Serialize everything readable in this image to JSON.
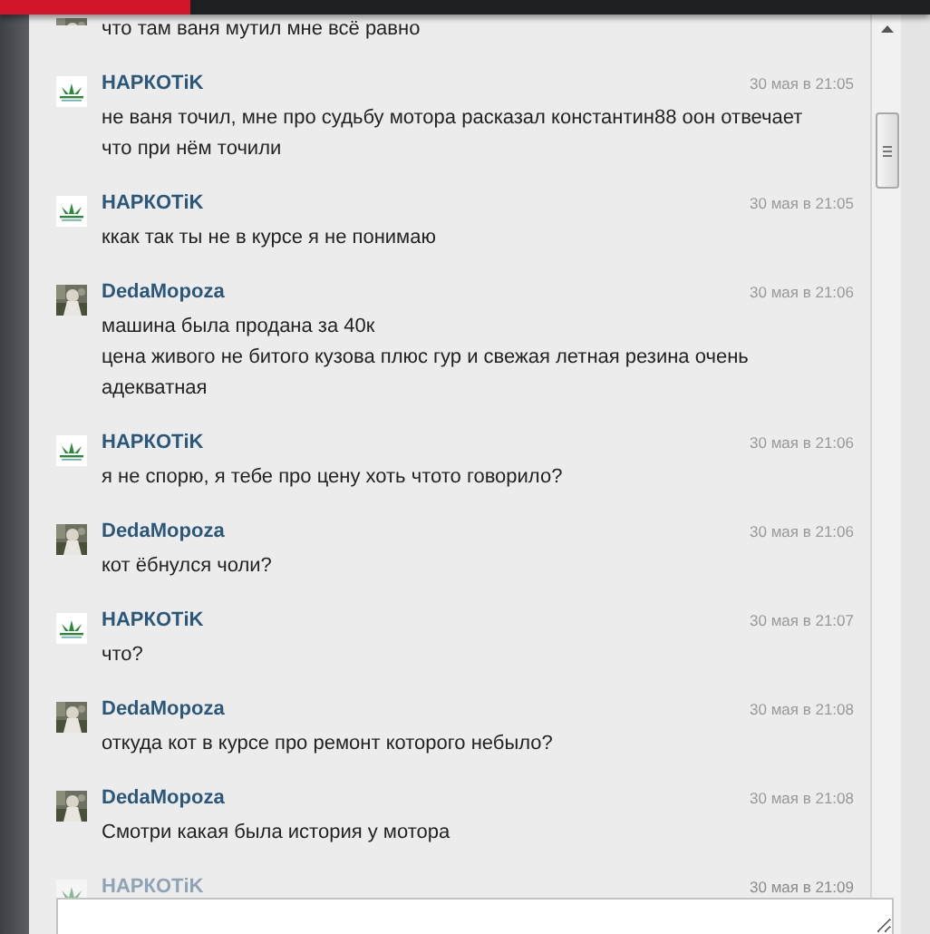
{
  "messages": [
    {
      "continued": true,
      "lines": [
        "что там ваня мутил мне всё равно"
      ]
    },
    {
      "kind": "logo",
      "author": "НАРКОТiK",
      "time": "30 мая в 21:05",
      "faded": false,
      "lines": [
        "не ваня точил, мне про судьбу мотора расказал константин88 оон отвечает что при нём точили"
      ]
    },
    {
      "kind": "logo",
      "author": "НАРКОТiK",
      "time": "30 мая в 21:05",
      "faded": false,
      "lines": [
        "ккак так ты не в курсе я не понимаю"
      ]
    },
    {
      "author": "DedaMopoza",
      "time": "30 мая в 21:06",
      "faded": false,
      "lines": [
        "машина была продана за 40к",
        "цена живого не битого кузова плюс гур и свежая летная резина очень адекватная"
      ]
    },
    {
      "kind": "logo",
      "author": "НАРКОТiK",
      "time": "30 мая в 21:06",
      "faded": false,
      "lines": [
        "я не спорю, я тебе про цену хоть чтото говорило?"
      ]
    },
    {
      "author": "DedaMopoza",
      "time": "30 мая в 21:06",
      "faded": false,
      "lines": [
        "кот ёбнулся чоли?"
      ]
    },
    {
      "kind": "logo",
      "author": "НАРКОТiK",
      "time": "30 мая в 21:07",
      "faded": false,
      "lines": [
        "что?"
      ]
    },
    {
      "author": "DedaMopoza",
      "time": "30 мая в 21:08",
      "faded": false,
      "lines": [
        "откуда кот в курсе про ремонт которого небыло?"
      ]
    },
    {
      "author": "DedaMopoza",
      "time": "30 мая в 21:08",
      "faded": false,
      "lines": [
        "Смотри какая была история у мотора"
      ]
    },
    {
      "kind": "logo",
      "author": "НАРКОТiK",
      "time": "30 мая в 21:09",
      "faded": true
    }
  ]
}
